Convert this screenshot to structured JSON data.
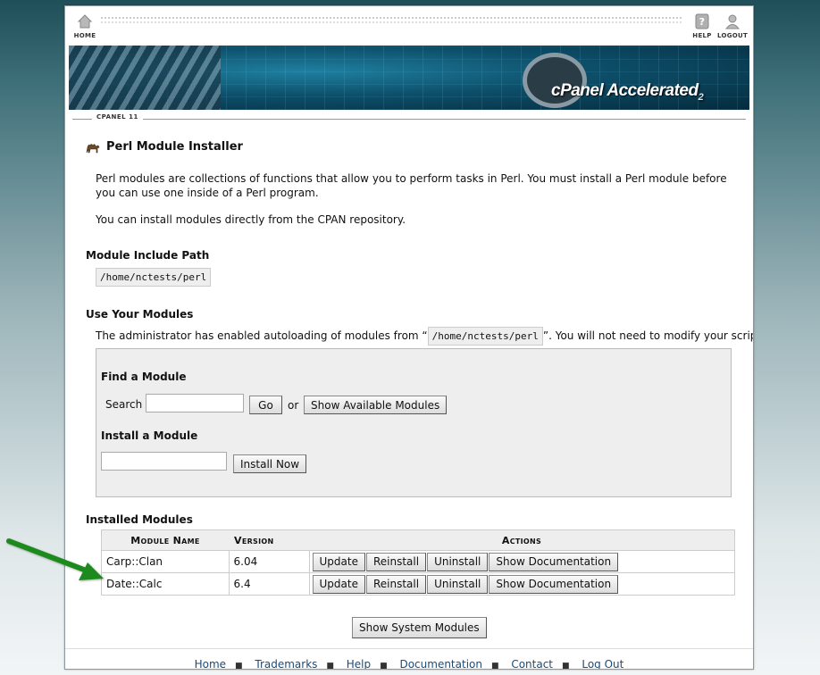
{
  "topbar": {
    "home_label": "HOME",
    "help_label": "HELP",
    "logout_label": "LOGOUT"
  },
  "banner": {
    "brand": "cPanel",
    "product": "Accelerated",
    "version_mark": "2"
  },
  "breadcrumb": "CPANEL 11",
  "page_title": "Perl Module Installer",
  "intro": {
    "p1": "Perl modules are collections of functions that allow you to perform tasks in Perl. You must install a Perl module before you can use one inside of a Perl program.",
    "p2": "You can install modules directly from the CPAN repository."
  },
  "include_path": {
    "heading": "Module Include Path",
    "value": "/home/nctests/perl"
  },
  "use_modules": {
    "heading": "Use Your Modules",
    "text_before": "The administrator has enabled autoloading of modules from “",
    "path": "/home/nctests/perl",
    "text_after": "”. You will not need to modify your scripts."
  },
  "find": {
    "heading": "Find a Module",
    "search_label": "Search",
    "search_value": "",
    "go_label": "Go",
    "or_label": "or",
    "show_available_label": "Show Available Modules"
  },
  "install": {
    "heading": "Install a Module",
    "input_value": "",
    "button_label": "Install Now"
  },
  "installed": {
    "heading": "Installed Modules",
    "columns": [
      "Module Name",
      "Version",
      "Actions"
    ],
    "rows": [
      {
        "name": "Carp::Clan",
        "version": "6.04"
      },
      {
        "name": "Date::Calc",
        "version": "6.4"
      }
    ],
    "actions": [
      "Update",
      "Reinstall",
      "Uninstall",
      "Show Documentation"
    ]
  },
  "show_system_label": "Show System Modules",
  "footer": [
    "Home",
    "Trademarks",
    "Help",
    "Documentation",
    "Contact",
    "Log Out"
  ],
  "colors": {
    "link": "#1a4b7a",
    "arrow": "#1f8a1f",
    "banner": "#0d4f6a"
  }
}
